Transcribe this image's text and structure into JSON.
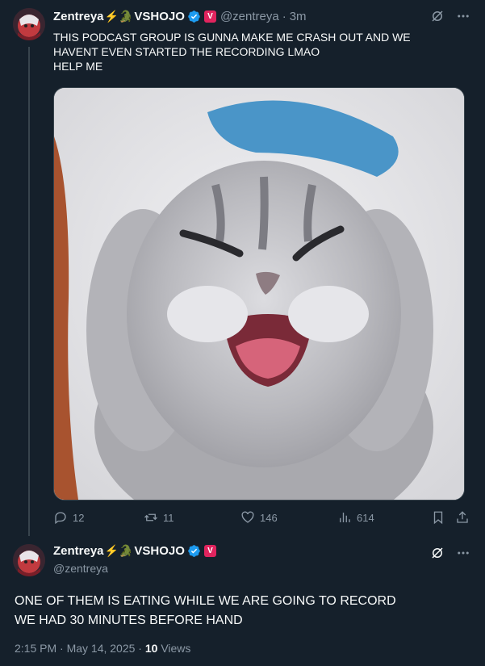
{
  "tweet1": {
    "display_name": "Zentreya",
    "name_emojis": "⚡🐊",
    "org": "VSHOJO",
    "badge_letter": "V",
    "handle": "@zentreya",
    "separator": "·",
    "time_ago": "3m",
    "text_lines": [
      "THIS PODCAST GROUP IS GUNNA MAKE ME CRASH OUT AND WE",
      "HAVENT EVEN STARTED THE RECORDING LMAO",
      "HELP ME"
    ],
    "media_icon": "laughing-cat-photo",
    "replies": "12",
    "reposts": "11",
    "likes": "146",
    "views": "614"
  },
  "tweet2": {
    "display_name": "Zentreya",
    "name_emojis": "⚡🐊",
    "org": "VSHOJO",
    "badge_letter": "V",
    "handle": "@zentreya",
    "text_lines": [
      "ONE OF THEM IS EATING WHILE WE ARE GOING TO RECORD",
      "WE HAD 30 MINUTES BEFORE HAND"
    ],
    "timestamp": "2:15 PM · May 14, 2025 · ",
    "view_count": "10",
    "views_label": " Views"
  },
  "colors": {
    "background": "#15202b",
    "text": "#f7f9f9",
    "muted": "#8b98a5",
    "verified": "#1d9bf0",
    "vbadge": "#e0245e"
  },
  "icons": [
    "grok-icon",
    "more-icon",
    "reply-icon",
    "repost-icon",
    "like-icon",
    "views-icon",
    "bookmark-icon",
    "share-icon",
    "verified-icon"
  ]
}
